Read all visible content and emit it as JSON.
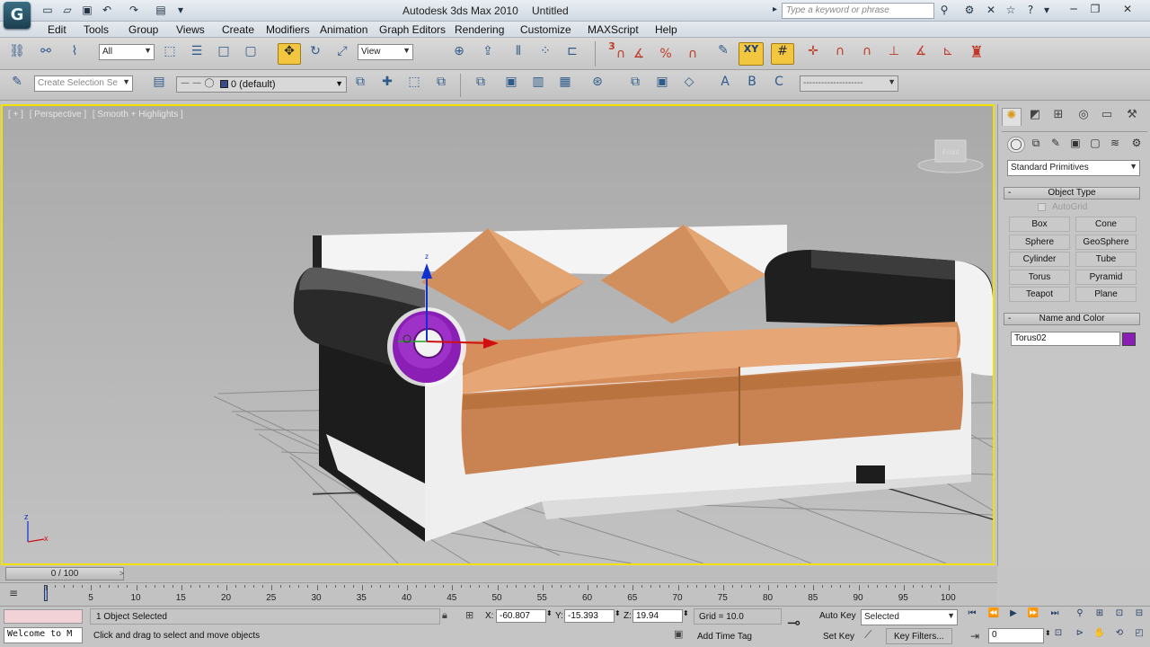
{
  "window": {
    "title": "Autodesk 3ds Max 2010",
    "document": "Untitled",
    "search_placeholder": "Type a keyword or phrase"
  },
  "menu": [
    "Edit",
    "Tools",
    "Group",
    "Views",
    "Create",
    "Modifiers",
    "Animation",
    "Graph Editors",
    "Rendering",
    "Customize",
    "MAXScript",
    "Help"
  ],
  "toolbar": {
    "selection_filter": "All",
    "ref_coord": "View",
    "axis_constraint": "XY",
    "snap_value": "3",
    "named_selection_placeholder": "Create Selection Se",
    "layer": "0 (default)"
  },
  "viewport": {
    "label_plus": "[ + ]",
    "label_view": "[ Perspective ]",
    "label_shading": "[ Smooth + Highlights ]",
    "gizmo_z": "z",
    "axis_x": "x",
    "axis_z": "z"
  },
  "command_panel": {
    "category": "Standard Primitives",
    "object_type_title": "Object Type",
    "autogrid": "AutoGrid",
    "primitives": [
      "Box",
      "Cone",
      "Sphere",
      "GeoSphere",
      "Cylinder",
      "Tube",
      "Torus",
      "Pyramid",
      "Teapot",
      "Plane"
    ],
    "name_color_title": "Name and Color",
    "object_name": "Torus02",
    "object_color": "#8b1fb5"
  },
  "timeline": {
    "slider_label": "0 / 100",
    "ticks": [
      "0",
      "5",
      "10",
      "15",
      "20",
      "25",
      "30",
      "35",
      "40",
      "45",
      "50",
      "55",
      "60",
      "65",
      "70",
      "75",
      "80",
      "85",
      "90",
      "95",
      "100"
    ]
  },
  "status": {
    "maxscript_listener": "Welcome to M",
    "selection": "1 Object Selected",
    "prompt": "Click and drag to select and move objects",
    "x_label": "X:",
    "x_value": "-60.807",
    "y_label": "Y:",
    "y_value": "-15.393",
    "z_label": "Z:",
    "z_value": "19.94",
    "grid": "Grid = 10.0",
    "add_time_tag": "Add Time Tag",
    "auto_key": "Auto Key",
    "set_key": "Set Key",
    "key_mode": "Selected",
    "key_filters": "Key Filters...",
    "current_frame": "0"
  },
  "colors": {
    "viewport_border": "#f2e100",
    "sofa_cushion": "#d68f5e",
    "torus": "#8b1fb5"
  }
}
